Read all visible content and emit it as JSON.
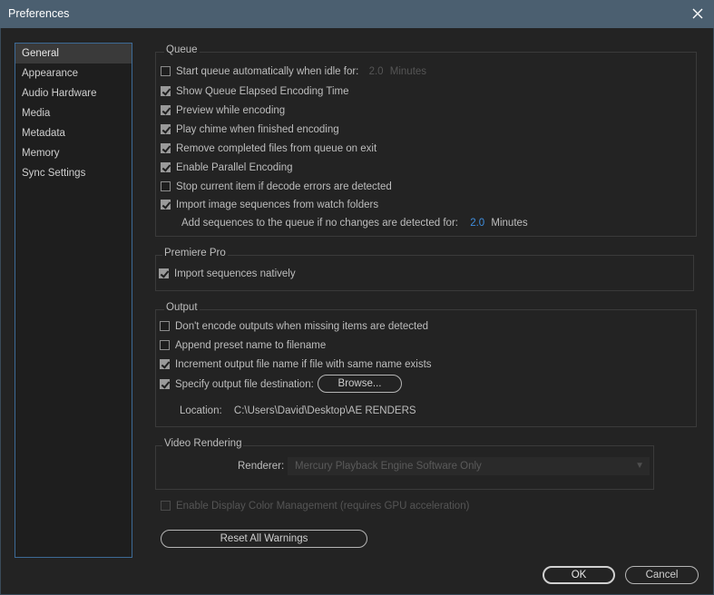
{
  "window": {
    "title": "Preferences"
  },
  "sidebar": {
    "items": [
      {
        "label": "General"
      },
      {
        "label": "Appearance"
      },
      {
        "label": "Audio Hardware"
      },
      {
        "label": "Media"
      },
      {
        "label": "Metadata"
      },
      {
        "label": "Memory"
      },
      {
        "label": "Sync Settings"
      }
    ],
    "selected": "General"
  },
  "queue": {
    "title": "Queue",
    "start_auto": {
      "label": "Start queue automatically when idle for:",
      "checked": false,
      "value": "2.0",
      "unit": "Minutes"
    },
    "show_elapsed": {
      "label": "Show Queue Elapsed Encoding Time",
      "checked": true
    },
    "preview": {
      "label": "Preview while encoding",
      "checked": true
    },
    "chime": {
      "label": "Play chime when finished encoding",
      "checked": true
    },
    "remove_completed": {
      "label": "Remove completed files from queue on exit",
      "checked": true
    },
    "parallel": {
      "label": "Enable Parallel Encoding",
      "checked": true
    },
    "stop_current": {
      "label": "Stop current item if decode errors are detected",
      "checked": false
    },
    "import_sequences": {
      "label": "Import image sequences from watch folders",
      "checked": true
    },
    "add_sequences": {
      "label": "Add sequences to the queue if no changes are detected for:",
      "value": "2.0",
      "unit": "Minutes"
    }
  },
  "premiere": {
    "title": "Premiere Pro",
    "import_natively": {
      "label": "Import sequences natively",
      "checked": true
    }
  },
  "output": {
    "title": "Output",
    "dont_encode": {
      "label": "Don't encode outputs when missing items are detected",
      "checked": false
    },
    "append_preset": {
      "label": "Append preset name to filename",
      "checked": false
    },
    "increment": {
      "label": "Increment output file name if file with same name exists",
      "checked": true
    },
    "specify_dest": {
      "label": "Specify output file destination:",
      "checked": true
    },
    "browse_label": "Browse...",
    "location_label": "Location:",
    "location_value": "C:\\Users\\David\\Desktop\\AE RENDERS"
  },
  "video_rendering": {
    "title": "Video Rendering",
    "renderer_label": "Renderer:",
    "renderer_value": "Mercury Playback Engine Software Only"
  },
  "color_mgmt": {
    "label": "Enable Display Color Management (requires GPU acceleration)",
    "checked": false,
    "disabled": true
  },
  "buttons": {
    "reset_warnings": "Reset All Warnings",
    "ok": "OK",
    "cancel": "Cancel"
  },
  "colors": {
    "titlebar": "#4b5f70",
    "background": "#232323",
    "accent_value": "#3f8fe0",
    "sidebar_border": "#3d6a96"
  },
  "icons": {
    "close": "close-icon",
    "dropdown": "chevron-down-icon"
  }
}
